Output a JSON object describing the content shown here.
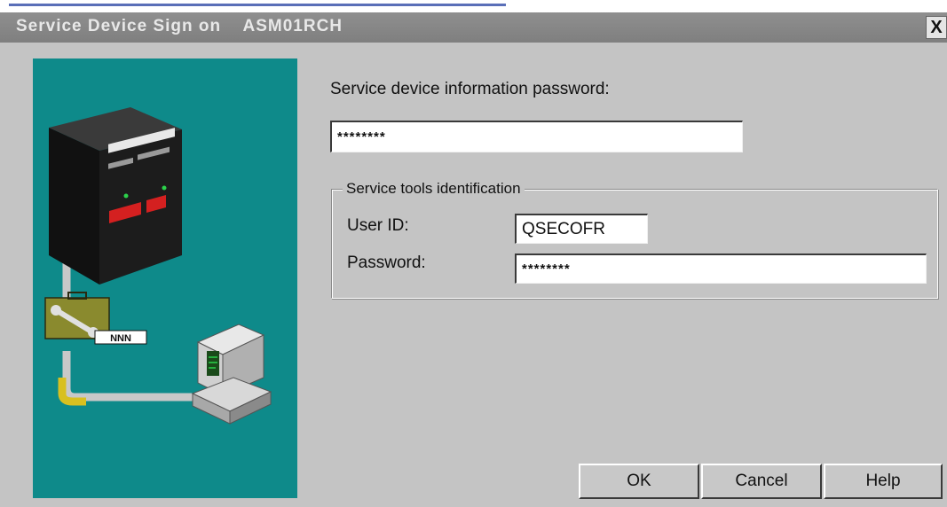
{
  "window": {
    "title": "Service Device Sign on    ASM01RCH",
    "close_label": "X"
  },
  "illustration": {
    "device_tag": "NNN"
  },
  "service_device": {
    "password_label": "Service device information password:",
    "password_value": "********"
  },
  "service_tools": {
    "group_label": "Service tools identification",
    "user_id_label": "User ID:",
    "user_id_value": "QSECOFR",
    "password_label": "Password:",
    "password_value": "********"
  },
  "buttons": {
    "ok": "OK",
    "cancel": "Cancel",
    "help": "Help"
  },
  "colors": {
    "dialog_bg": "#c4c4c4",
    "titlebar": "#8a8a8a",
    "illustration_bg": "#0e8a8a"
  },
  "icons": [
    "server-icon",
    "toolbox-icon",
    "wrench-icon",
    "computer-icon",
    "close-icon"
  ]
}
